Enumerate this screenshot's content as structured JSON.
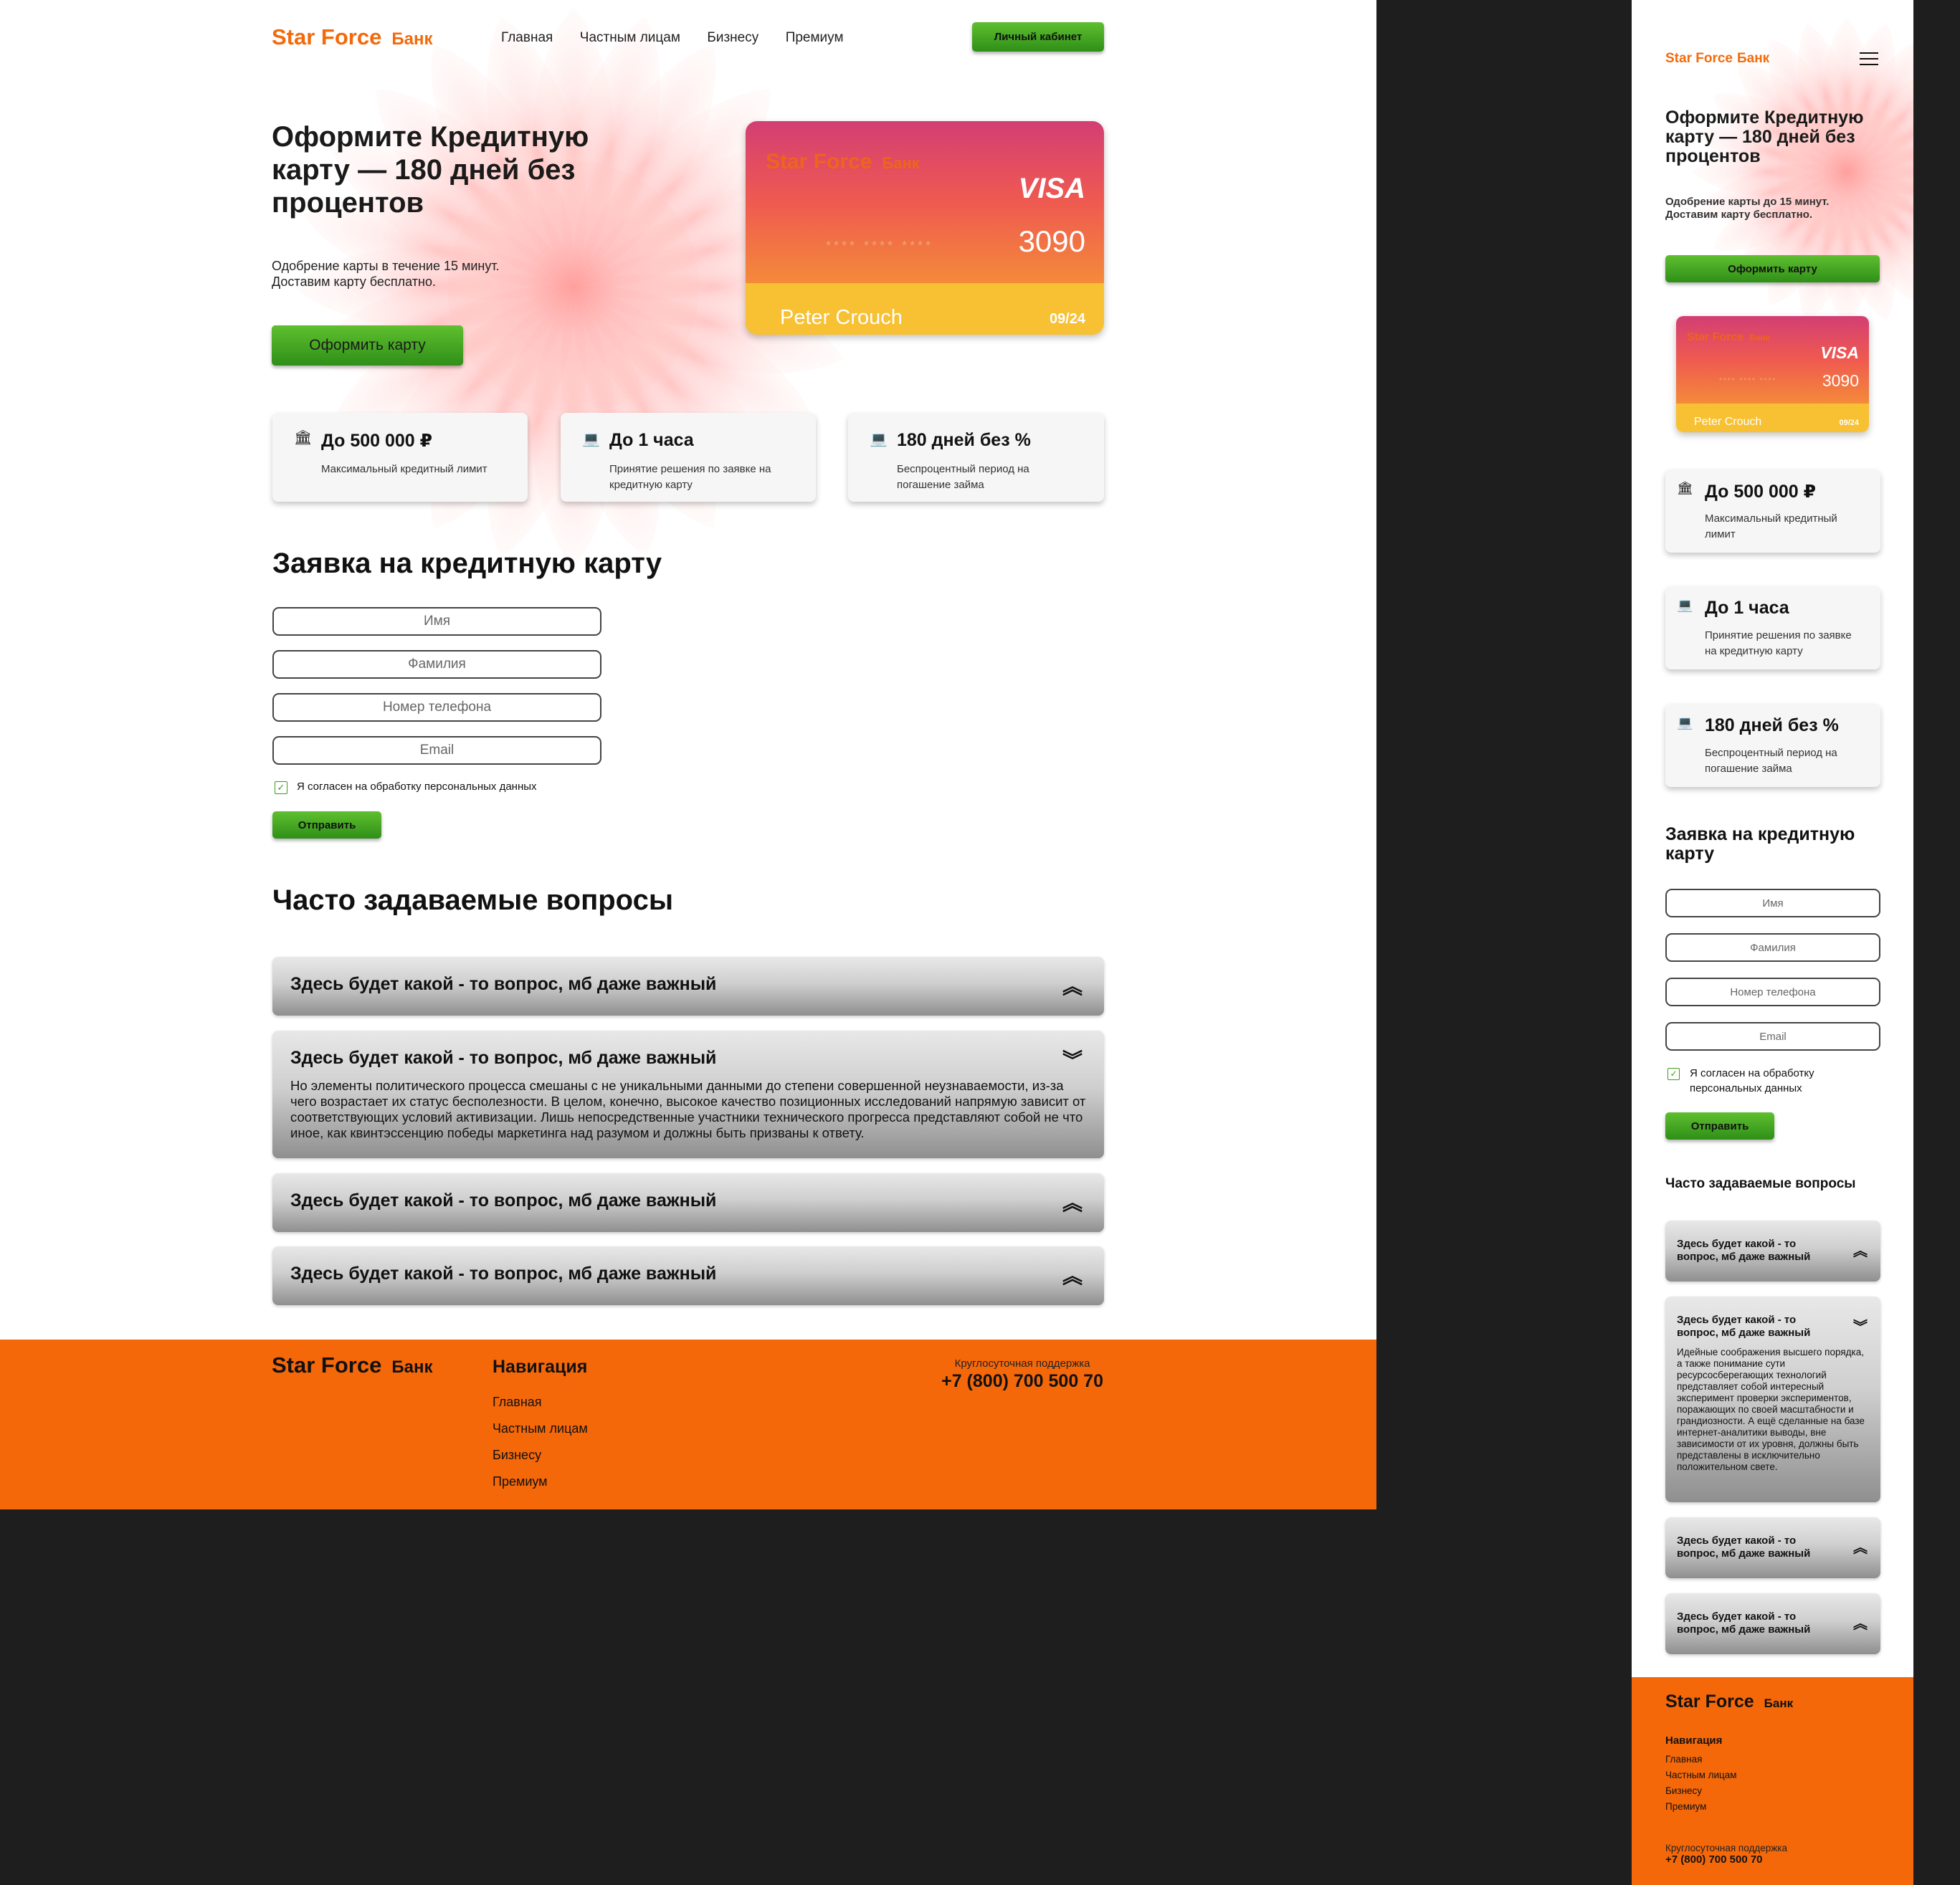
{
  "brand": {
    "name": "Star Force",
    "suffix": "Банк"
  },
  "colors": {
    "accent": "#f36a0b",
    "green": "#3b9b1b",
    "footer": "#f4680a",
    "card_top": "#ef5a50",
    "card_bottom": "#f8c033"
  },
  "header": {
    "nav": [
      "Главная",
      "Частным лицам",
      "Бизнесу",
      "Премиум"
    ],
    "cabinet_button": "Личный кабинет",
    "menu_icon": "hamburger-icon"
  },
  "hero": {
    "title_line1": "Оформите Кредитную",
    "title_line2": "карту — 180 дней без",
    "title_line3": "процентов",
    "subtitle_line1": "Одобрение карты в течение 15 минут.",
    "subtitle_line2": "Доставим карту бесплатно.",
    "mobile_subtitle_line1": "Одобрение карты до 15 минут.",
    "cta": "Оформить карту"
  },
  "card": {
    "network": "VISA",
    "masked": "**** **** ****",
    "last4": "3090",
    "holder": "Peter Crouch",
    "expiry": "09/24"
  },
  "features": [
    {
      "icon": "bank-icon",
      "title": "До 500 000 ₽",
      "desc": "Максимальный кредитный лимит"
    },
    {
      "icon": "laptop-icon",
      "title": "До 1 часа",
      "desc": "Принятие решения по заявке на кредитную карту"
    },
    {
      "icon": "laptop-icon",
      "title": "180 дней без %",
      "desc": "Беспроцентный период на погашение займа"
    }
  ],
  "form": {
    "title": "Заявка на кредитную карту",
    "fields": [
      "Имя",
      "Фамилия",
      "Номер телефона",
      "Email"
    ],
    "consent": "Я согласен на обработку персональных данных",
    "consent_checked": true,
    "submit": "Отправить"
  },
  "faq": {
    "title": "Часто задаваемые вопросы",
    "question": "Здесь будет какой - то вопрос, мб даже важный",
    "answer_desktop": "Но элементы политического процесса смешаны с не уникальными данными до степени совершенной неузнаваемости, из-за чего возрастает их статус бесполезности. В целом, конечно, высокое качество позиционных исследований напрямую зависит от соответствующих условий активизации. Лишь непосредственные участники технического прогресса представляют собой не что иное, как квинтэссенцию победы маркетинга над разумом и должны быть призваны к ответу.",
    "answer_mobile": "Идейные соображения высшего порядка, а также понимание сути ресурсосберегающих технологий представляет собой интересный эксперимент проверки экспериментов, поражающих по своей масштабности и грандиозности. А ещё сделанные на базе интернет-аналитики выводы, вне зависимости от их уровня, должны быть представлены в исключительно положительном свете.",
    "expanded_index": 1
  },
  "footer": {
    "nav_title": "Навигация",
    "nav": [
      "Главная",
      "Частным лицам",
      "Бизнесу",
      "Премиум"
    ],
    "support_label": "Круглосуточная поддержка",
    "phone": "+7 (800) 700 500 70"
  }
}
